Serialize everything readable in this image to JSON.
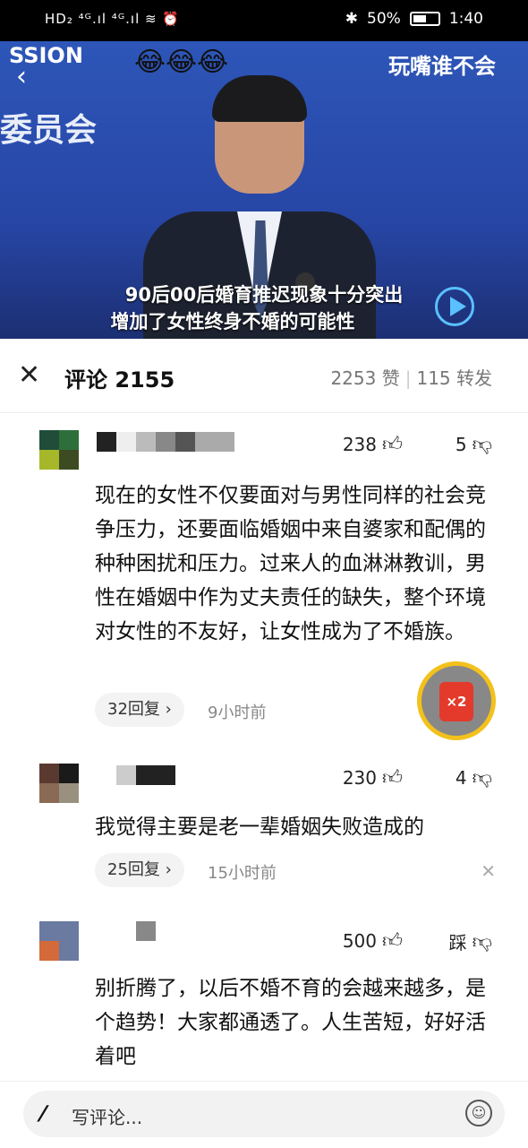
{
  "status_bar": {
    "left": "HD₂ ⁴ᴳ.ıl ⁴ᴳ.ıl ≋ ⏰",
    "battery_text": "50%",
    "time": "1:40"
  },
  "video": {
    "bg_text": "委员会",
    "top_text": "SSION",
    "channel": "玩嘴谁不会",
    "emojis": "😂😂😂",
    "caption_line1": "90后00后婚育推迟现象十分突出",
    "caption_line2": "增加了女性终身不婚的可能性"
  },
  "header": {
    "title": "评论 2155",
    "likes": "2253 赞",
    "shares": "115 转发"
  },
  "comments": [
    {
      "likes": "238",
      "dislikes": "5",
      "text": "现在的女性不仅要面对与男性同样的社会竞争压力，还要面临婚姻中来自婆家和配偶的种种困扰和压力。过来人的血淋淋教训，男性在婚姻中作为丈夫责任的缺失，整个环境对女性的不友好，让女性成为了不婚族。",
      "replies": "32回复 ›",
      "time": "9小时前"
    },
    {
      "likes": "230",
      "dislikes": "4",
      "text": "我觉得主要是老一辈婚姻失败造成的",
      "replies": "25回复 ›",
      "time": "15小时前"
    },
    {
      "likes": "500",
      "dislikes": "踩",
      "text": "别折腾了，以后不婚不育的会越来越多，是个趋势！大家都通透了。人生苦短，好好活着吧"
    }
  ],
  "red_packet": "×2",
  "bottom": {
    "placeholder": "写评论..."
  }
}
